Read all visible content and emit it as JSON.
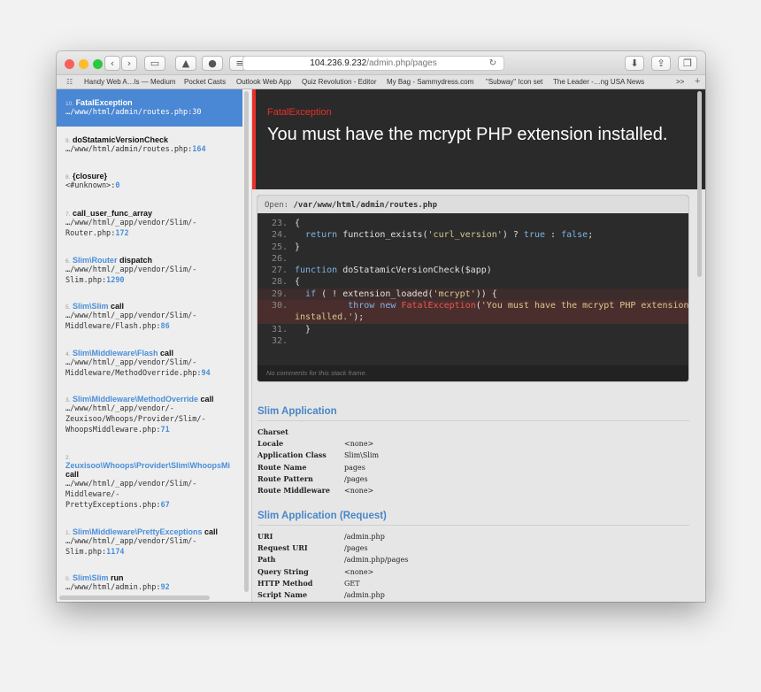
{
  "browser": {
    "address_host": "104.236.9.232",
    "address_path": "/admin.php/pages",
    "bookmarks": [
      "Handy Web A…ls — Medium",
      "Pocket Casts",
      "Outlook Web App",
      "Quiz Revolution - Editor",
      "My Bag - Sammydress.com",
      "\"Subway\" Icon set",
      "The Leader -…ng USA News"
    ],
    "overflow": ">>",
    "add": "+"
  },
  "frames": [
    {
      "idx": "10.",
      "cls": "FatalException",
      "fn": "",
      "file": "…/www/html/admin/routes.php",
      "line": "30",
      "active": true
    },
    {
      "idx": "9.",
      "cls": "",
      "fn": "doStatamicVersionCheck",
      "file": "…/www/html/admin/routes.php",
      "line": "164"
    },
    {
      "idx": "8.",
      "cls": "",
      "fn": "{closure}",
      "file": "<#unknown>",
      "line": "0"
    },
    {
      "idx": "7.",
      "cls": "",
      "fn": "call_user_func_array",
      "file": "…/www/html/_app/vendor/Slim/-\nRouter.php",
      "line": "172"
    },
    {
      "idx": "6.",
      "cls": "Slim\\Router",
      "fn": "dispatch",
      "file": "…/www/html/_app/vendor/Slim/-\nSlim.php",
      "line": "1290"
    },
    {
      "idx": "5.",
      "cls": "Slim\\Slim",
      "fn": "call",
      "file": "…/www/html/_app/vendor/Slim/-\nMiddleware/Flash.php",
      "line": "86"
    },
    {
      "idx": "4.",
      "cls": "Slim\\Middleware\\Flash",
      "fn": "call",
      "file": "…/www/html/_app/vendor/Slim/-\nMiddleware/MethodOverride.php",
      "line": "94"
    },
    {
      "idx": "3.",
      "cls": "Slim\\Middleware\\MethodOverride",
      "fn": "call",
      "file": "…/www/html/_app/vendor/-\nZeuxisoo/Whoops/Provider/Slim/-\nWhoopsMiddleware.php",
      "line": "71"
    },
    {
      "idx": "2.",
      "cls": "Zeuxisoo\\Whoops\\Provider\\Slim\\WhoopsMi",
      "fn": "call",
      "file": "…/www/html/_app/vendor/Slim/-\nMiddleware/-\nPrettyExceptions.php",
      "line": "67"
    },
    {
      "idx": "1.",
      "cls": "Slim\\Middleware\\PrettyExceptions",
      "fn": "call",
      "file": "…/www/html/_app/vendor/Slim/-\nSlim.php",
      "line": "1174"
    },
    {
      "idx": "0.",
      "cls": "Slim\\Slim",
      "fn": "run",
      "file": "…/www/html/admin.php",
      "line": "92"
    }
  ],
  "exception": {
    "name": "FatalException",
    "message": "You must have the mcrypt PHP extension installed."
  },
  "code": {
    "open_label": "Open:",
    "open_path": "/var/www/html/admin/routes.php",
    "no_comments": "No comments for this stack frame."
  },
  "sections": [
    {
      "title": "Slim Application",
      "rows": [
        {
          "k": "Charset",
          "v": ""
        },
        {
          "k": "Locale",
          "v": "<none>"
        },
        {
          "k": "Application Class",
          "v": "Slim\\Slim"
        },
        {
          "k": "Route Name",
          "v": "pages"
        },
        {
          "k": "Route Pattern",
          "v": "/pages"
        },
        {
          "k": "Route Middleware",
          "v": "<none>"
        }
      ]
    },
    {
      "title": "Slim Application (Request)",
      "rows": [
        {
          "k": "URI",
          "v": "/admin.php"
        },
        {
          "k": "Request URI",
          "v": "/pages"
        },
        {
          "k": "Path",
          "v": "/admin.php/pages"
        },
        {
          "k": "Query String",
          "v": "<none>"
        },
        {
          "k": "HTTP Method",
          "v": "GET"
        },
        {
          "k": "Script Name",
          "v": "/admin.php"
        }
      ]
    }
  ]
}
